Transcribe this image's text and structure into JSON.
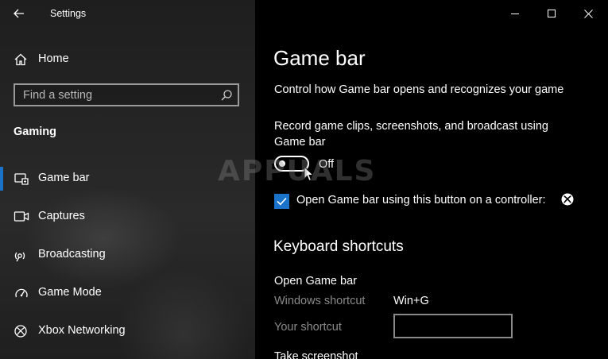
{
  "window": {
    "title": "Settings"
  },
  "sidebar": {
    "home_label": "Home",
    "search_placeholder": "Find a setting",
    "section_title": "Gaming",
    "items": [
      {
        "label": "Game bar",
        "icon": "game-bar-icon",
        "active": true
      },
      {
        "label": "Captures",
        "icon": "captures-icon",
        "active": false
      },
      {
        "label": "Broadcasting",
        "icon": "broadcasting-icon",
        "active": false
      },
      {
        "label": "Game Mode",
        "icon": "game-mode-icon",
        "active": false
      },
      {
        "label": "Xbox Networking",
        "icon": "xbox-icon",
        "active": false
      }
    ]
  },
  "main": {
    "title": "Game bar",
    "description": "Control how Game bar opens and recognizes your game",
    "record_label": "Record game clips, screenshots, and broadcast using Game bar",
    "toggle_state": "Off",
    "checkbox_label": "Open Game bar using this button on a controller:",
    "checkbox_checked": true,
    "keyboard_title": "Keyboard shortcuts",
    "open_group": "Open Game bar",
    "windows_shortcut_label": "Windows shortcut",
    "windows_shortcut_value": "Win+G",
    "your_shortcut_label": "Your shortcut",
    "next_group": "Take screenshot"
  },
  "watermark": "APPUALS",
  "colors": {
    "accent": "#1a73c9",
    "sidebar_bg": "#262626",
    "content_bg": "#000000",
    "muted_text": "#8a8a8a"
  }
}
